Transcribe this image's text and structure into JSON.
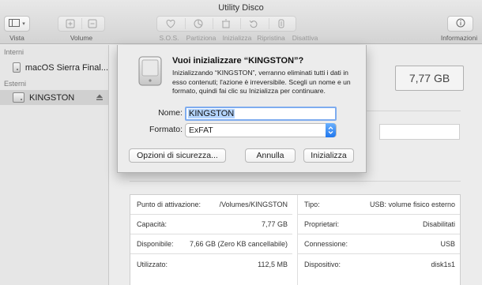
{
  "window": {
    "title": "Utility Disco"
  },
  "toolbar": {
    "view_label": "Vista",
    "volume_label": "Volume",
    "sos_label": "S.O.S.",
    "partition_label": "Partiziona",
    "erase_label": "Inizializza",
    "restore_label": "Ripristina",
    "unmount_label": "Disattiva",
    "info_label": "Informazioni"
  },
  "sidebar": {
    "internal_header": "Interni",
    "internal_items": [
      {
        "label": "macOS Sierra Final..."
      }
    ],
    "external_header": "Esterni",
    "external_items": [
      {
        "label": "KINGSTON",
        "selected": true
      }
    ]
  },
  "main": {
    "capacity_display": "7,77 GB",
    "info_left": [
      {
        "key": "Punto di attivazione:",
        "value": "/Volumes/KINGSTON"
      },
      {
        "key": "Capacità:",
        "value": "7,77 GB"
      },
      {
        "key": "Disponibile:",
        "value": "7,66 GB (Zero KB cancellabile)"
      },
      {
        "key": "Utilizzato:",
        "value": "112,5 MB"
      }
    ],
    "info_right": [
      {
        "key": "Tipo:",
        "value": "USB: volume fisico esterno"
      },
      {
        "key": "Proprietari:",
        "value": "Disabilitati"
      },
      {
        "key": "Connessione:",
        "value": "USB"
      },
      {
        "key": "Dispositivo:",
        "value": "disk1s1"
      }
    ]
  },
  "dialog": {
    "title": "Vuoi inizializzare “KINGSTON”?",
    "message": "Inizializzando “KINGSTON”, verranno eliminati tutti i dati in esso contenuti; l'azione è irreversibile. Scegli un nome e un formato, quindi fai clic su Inizializza per continuare.",
    "name_label": "Nome:",
    "name_value": "KINGSTON",
    "format_label": "Formato:",
    "format_value": "ExFAT",
    "security_button": "Opzioni di sicurezza...",
    "cancel_button": "Annulla",
    "erase_button": "Inizializza"
  },
  "colors": {
    "accent": "#2f7ef5",
    "selection": "#b4d4fd"
  }
}
